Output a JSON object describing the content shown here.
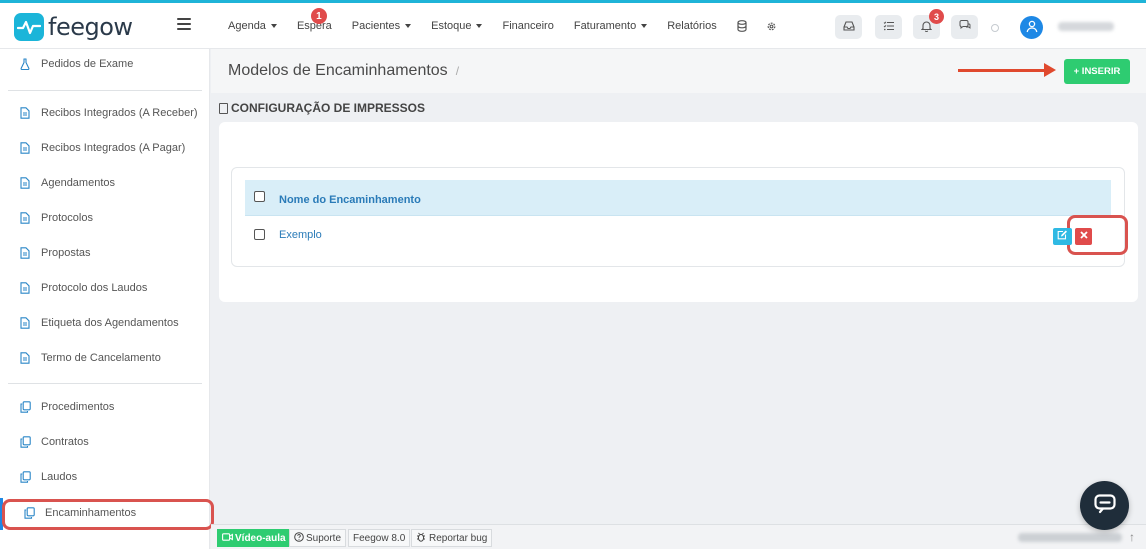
{
  "app": {
    "logo_text": "feegow"
  },
  "nav": {
    "items": [
      {
        "label": "Agenda",
        "dropdown": true
      },
      {
        "label": "Espera",
        "badge": "1"
      },
      {
        "label": "Pacientes",
        "dropdown": true
      },
      {
        "label": "Estoque",
        "dropdown": true
      },
      {
        "label": "Financeiro"
      },
      {
        "label": "Faturamento",
        "dropdown": true
      },
      {
        "label": "Relatórios"
      }
    ],
    "icons": [
      "database-icon",
      "gear-icon"
    ]
  },
  "header_buttons": {
    "inbox_icon": "inbox-icon",
    "tasks_icon": "tasks-icon",
    "notifications_icon": "bell-icon",
    "notifications_badge": "3",
    "chat_icon": "chat-bubble-icon",
    "avatar_icon": "user-icon"
  },
  "sidebar": {
    "items": [
      {
        "label": "Pedidos de Exame",
        "icon": "flask-icon"
      },
      {
        "label": "Recibos Integrados (A Receber)",
        "icon": "document-icon"
      },
      {
        "label": "Recibos Integrados (A Pagar)",
        "icon": "document-icon"
      },
      {
        "label": "Agendamentos",
        "icon": "document-icon"
      },
      {
        "label": "Protocolos",
        "icon": "document-icon"
      },
      {
        "label": "Propostas",
        "icon": "document-icon"
      },
      {
        "label": "Protocolo dos Laudos",
        "icon": "document-icon"
      },
      {
        "label": "Etiqueta dos Agendamentos",
        "icon": "document-icon"
      },
      {
        "label": "Termo de Cancelamento",
        "icon": "document-icon"
      },
      {
        "label": "Procedimentos",
        "icon": "copy-icon"
      },
      {
        "label": "Contratos",
        "icon": "copy-icon"
      },
      {
        "label": "Laudos",
        "icon": "copy-icon"
      },
      {
        "label": "Encaminhamentos",
        "icon": "copy-icon",
        "active": true
      }
    ]
  },
  "main": {
    "page_title": "Modelos de Encaminhamentos",
    "breadcrumb_sep": "/",
    "insert_label": "+ INSERIR",
    "section_title": "CONFIGURAÇÃO DE IMPRESSOS",
    "table": {
      "header": "Nome do Encaminhamento",
      "rows": [
        {
          "name": "Exemplo"
        }
      ]
    }
  },
  "footer": {
    "video_label": "Vídeo-aula",
    "support_label": "Suporte",
    "version_label": "Feegow 8.0",
    "bug_label": "Reportar bug"
  },
  "colors": {
    "brand": "#1bb5d9",
    "insert_green": "#2ecc71",
    "edit_blue": "#2fb9e3",
    "delete_red": "#e04b4b",
    "highlight_red": "#d9534f",
    "link_blue": "#2a7bb8"
  }
}
